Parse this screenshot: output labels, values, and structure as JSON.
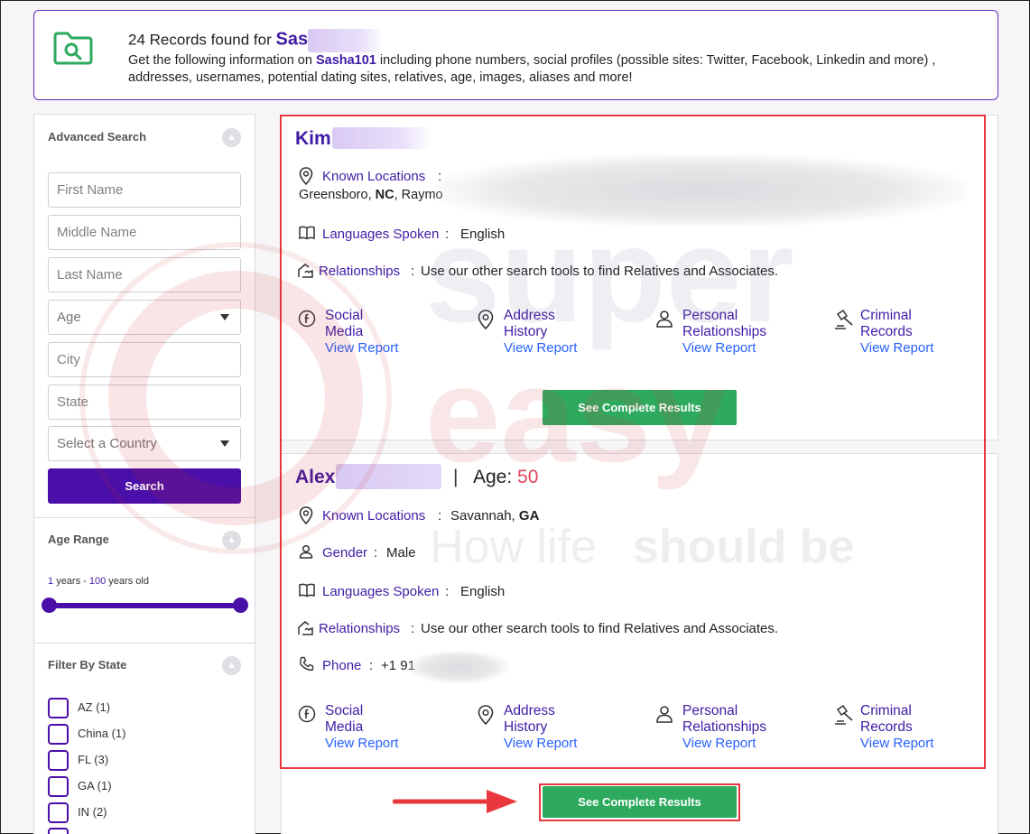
{
  "banner": {
    "count_text": "24 Records found for",
    "query": "Sas",
    "desc_prefix": "Get the following information on",
    "username": "Sasha101",
    "desc_suffix": "including phone numbers, social profiles (possible sites: Twitter, Facebook, Linkedin and more) , addresses, usernames, potential dating sites, relatives, age, images, aliases and more!"
  },
  "sidebar": {
    "advanced_search_label": "Advanced Search",
    "first_name_placeholder": "First Name",
    "middle_name_placeholder": "Middle Name",
    "last_name_placeholder": "Last Name",
    "age_label": "Age",
    "city_placeholder": "City",
    "state_placeholder": "State",
    "country_label": "Select a Country",
    "search_label": "Search",
    "age_range_label": "Age Range",
    "age_min": "1",
    "age_years_text": "years -",
    "age_max": "100",
    "age_old_text": "years old",
    "filter_state_label": "Filter By State",
    "states": [
      "AZ (1)",
      "China (1)",
      "FL (3)",
      "GA (1)",
      "IN (2)"
    ]
  },
  "result1": {
    "name": "Kim",
    "known_locations_label": "Known Locations",
    "locations_text_1": "Greensboro,",
    "locations_state_1": "NC",
    "locations_text_2": "Raymo",
    "languages_label": "Languages Spoken",
    "languages_value": "English",
    "relationships_label": "Relationships",
    "relationships_value": "Use our other search tools to find Relatives and Associates.",
    "see_results_label": "See Complete Results"
  },
  "result2": {
    "name": "Alex",
    "age_label": "Age:",
    "age_value": "50",
    "known_locations_label": "Known Locations",
    "location_city": "Savannah,",
    "location_state": "GA",
    "gender_label": "Gender",
    "gender_value": "Male",
    "languages_label": "Languages Spoken",
    "languages_value": "English",
    "relationships_label": "Relationships",
    "relationships_value": "Use our other search tools to find Relatives and Associates.",
    "phone_label": "Phone",
    "phone_value": "+1 91",
    "see_results_label": "See Complete Results"
  },
  "features": {
    "social_1": "Social",
    "social_2": "Media",
    "address_1": "Address",
    "address_2": "History",
    "personal_1": "Personal",
    "personal_2": "Relationships",
    "criminal_1": "Criminal",
    "criminal_2": "Records",
    "view_report": "View Report"
  },
  "watermark": {
    "word1": "super",
    "word2": "easy",
    "tagline_1": "How life",
    "tagline_2": "should be"
  },
  "colors": {
    "brand_purple": "#3f1ca5",
    "button_purple": "#4a0fa8",
    "green": "#2eaa5e",
    "highlight_red": "#e8383d",
    "link_blue": "#2962ff"
  }
}
